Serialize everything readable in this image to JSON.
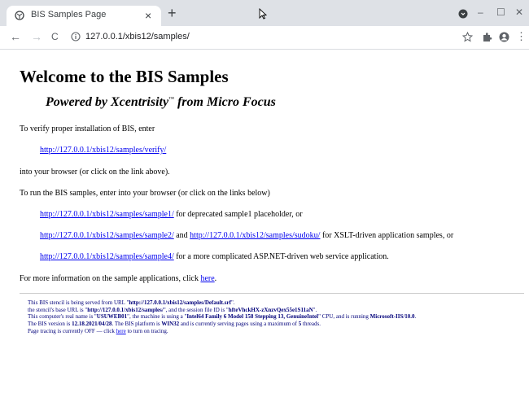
{
  "browser": {
    "tab_title": "BIS Samples Page",
    "tab_close": "×",
    "new_tab": "+",
    "minimize": "–",
    "maximize": "☐",
    "close": "✕",
    "back": "←",
    "forward": "→",
    "reload": "C",
    "url": "127.0.0.1/xbis12/samples/",
    "menu": "⋮"
  },
  "page": {
    "heading": "Welcome to the BIS Samples",
    "subtitle_pre": "Powered by Xcentrisity",
    "subtitle_tm": "™",
    "subtitle_post": " from Micro Focus",
    "verify_intro": "To verify proper installation of BIS, enter",
    "verify_link": "http://127.0.0.1/xbis12/samples/verify/",
    "verify_after": "into your browser (or click on the link above).",
    "run_intro": "To run the BIS samples, enter into your browser (or click on the links below)",
    "sample1_link": "http://127.0.0.1/xbis12/samples/sample1/",
    "sample1_text": " for deprecated sample1 placeholder, or",
    "sample2_link": "http://127.0.0.1/xbis12/samples/sample2/",
    "and_text": " and ",
    "sudoku_link": "http://127.0.0.1/xbis12/samples/sudoku/",
    "sudoku_text": " for XSLT-driven application samples, or",
    "sample4_link": "http://127.0.0.1/xbis12/samples/sample4/",
    "sample4_text": " for a more complicated ASP.NET-driven web service application.",
    "more_info": "For more information on the sample applications, click ",
    "here": "here",
    "period": "."
  },
  "footer": {
    "l1a": "This BIS stencil is being served from URL \"",
    "l1b": "http://127.0.0.1/xbis12/samples/Default.srf",
    "l1c": "\".",
    "l2a": "the stencil's base URL is \"",
    "l2b": "http://127.0.0.1/xbis12/samples/",
    "l2c": "\", and the session file ID is \"",
    "l2d": "hfteVhckHX-zXnzvQex55e1S11aN",
    "l2e": "\".",
    "l3a": "This computer's real name is \"",
    "l3b": "USUWEB01",
    "l3c": "\", the machine is using a \"",
    "l3d": "Intel64 Family 6 Model 158 Stepping 13, GenuineIntel",
    "l3e": "\" CPU, and is running ",
    "l3f": "Microsoft-IIS/10.0",
    "l3g": ".",
    "l4a": "The BIS version is ",
    "l4b": "12.18.2021/04/28",
    "l4c": ". The BIS platform is ",
    "l4d": "WIN32",
    "l4e": " and is currently serving pages using a maximum of ",
    "l4f": "5",
    "l4g": " threads.",
    "l5a": "Page tracing is currently OFF — click ",
    "l5b": "here",
    "l5c": " to turn on tracing."
  }
}
